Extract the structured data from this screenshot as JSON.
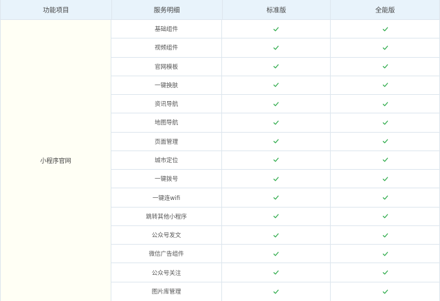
{
  "headers": {
    "feature": "功能项目",
    "detail": "服务明细",
    "standard": "标准版",
    "full": "全能版"
  },
  "group": "小程序官网",
  "colors": {
    "header_bg": "#e8f3fb",
    "group_bg": "#fffff5",
    "check": "#27a844",
    "border": "#dde6ee"
  },
  "rows": [
    {
      "detail": "基础组件",
      "standard": "check-icon",
      "full": "check-icon"
    },
    {
      "detail": "视频组件",
      "standard": "check-icon",
      "full": "check-icon"
    },
    {
      "detail": "官网模板",
      "standard": "check-icon",
      "full": "check-icon"
    },
    {
      "detail": "一键换肤",
      "standard": "check-icon",
      "full": "check-icon"
    },
    {
      "detail": "资讯导航",
      "standard": "check-icon",
      "full": "check-icon"
    },
    {
      "detail": "地图导航",
      "standard": "check-icon",
      "full": "check-icon"
    },
    {
      "detail": "页面管理",
      "standard": "check-icon",
      "full": "check-icon"
    },
    {
      "detail": "城市定位",
      "standard": "check-icon",
      "full": "check-icon"
    },
    {
      "detail": "一键拨号",
      "standard": "check-icon",
      "full": "check-icon"
    },
    {
      "detail": "一键连wifi",
      "standard": "check-icon",
      "full": "check-icon"
    },
    {
      "detail": "跳转其他小程序",
      "standard": "check-icon",
      "full": "check-icon"
    },
    {
      "detail": "公众号发文",
      "standard": "check-icon",
      "full": "check-icon"
    },
    {
      "detail": "微信广告组件",
      "standard": "check-icon",
      "full": "check-icon"
    },
    {
      "detail": "公众号关注",
      "standard": "check-icon",
      "full": "check-icon"
    },
    {
      "detail": "图片库管理",
      "standard": "check-icon",
      "full": "check-icon"
    }
  ]
}
